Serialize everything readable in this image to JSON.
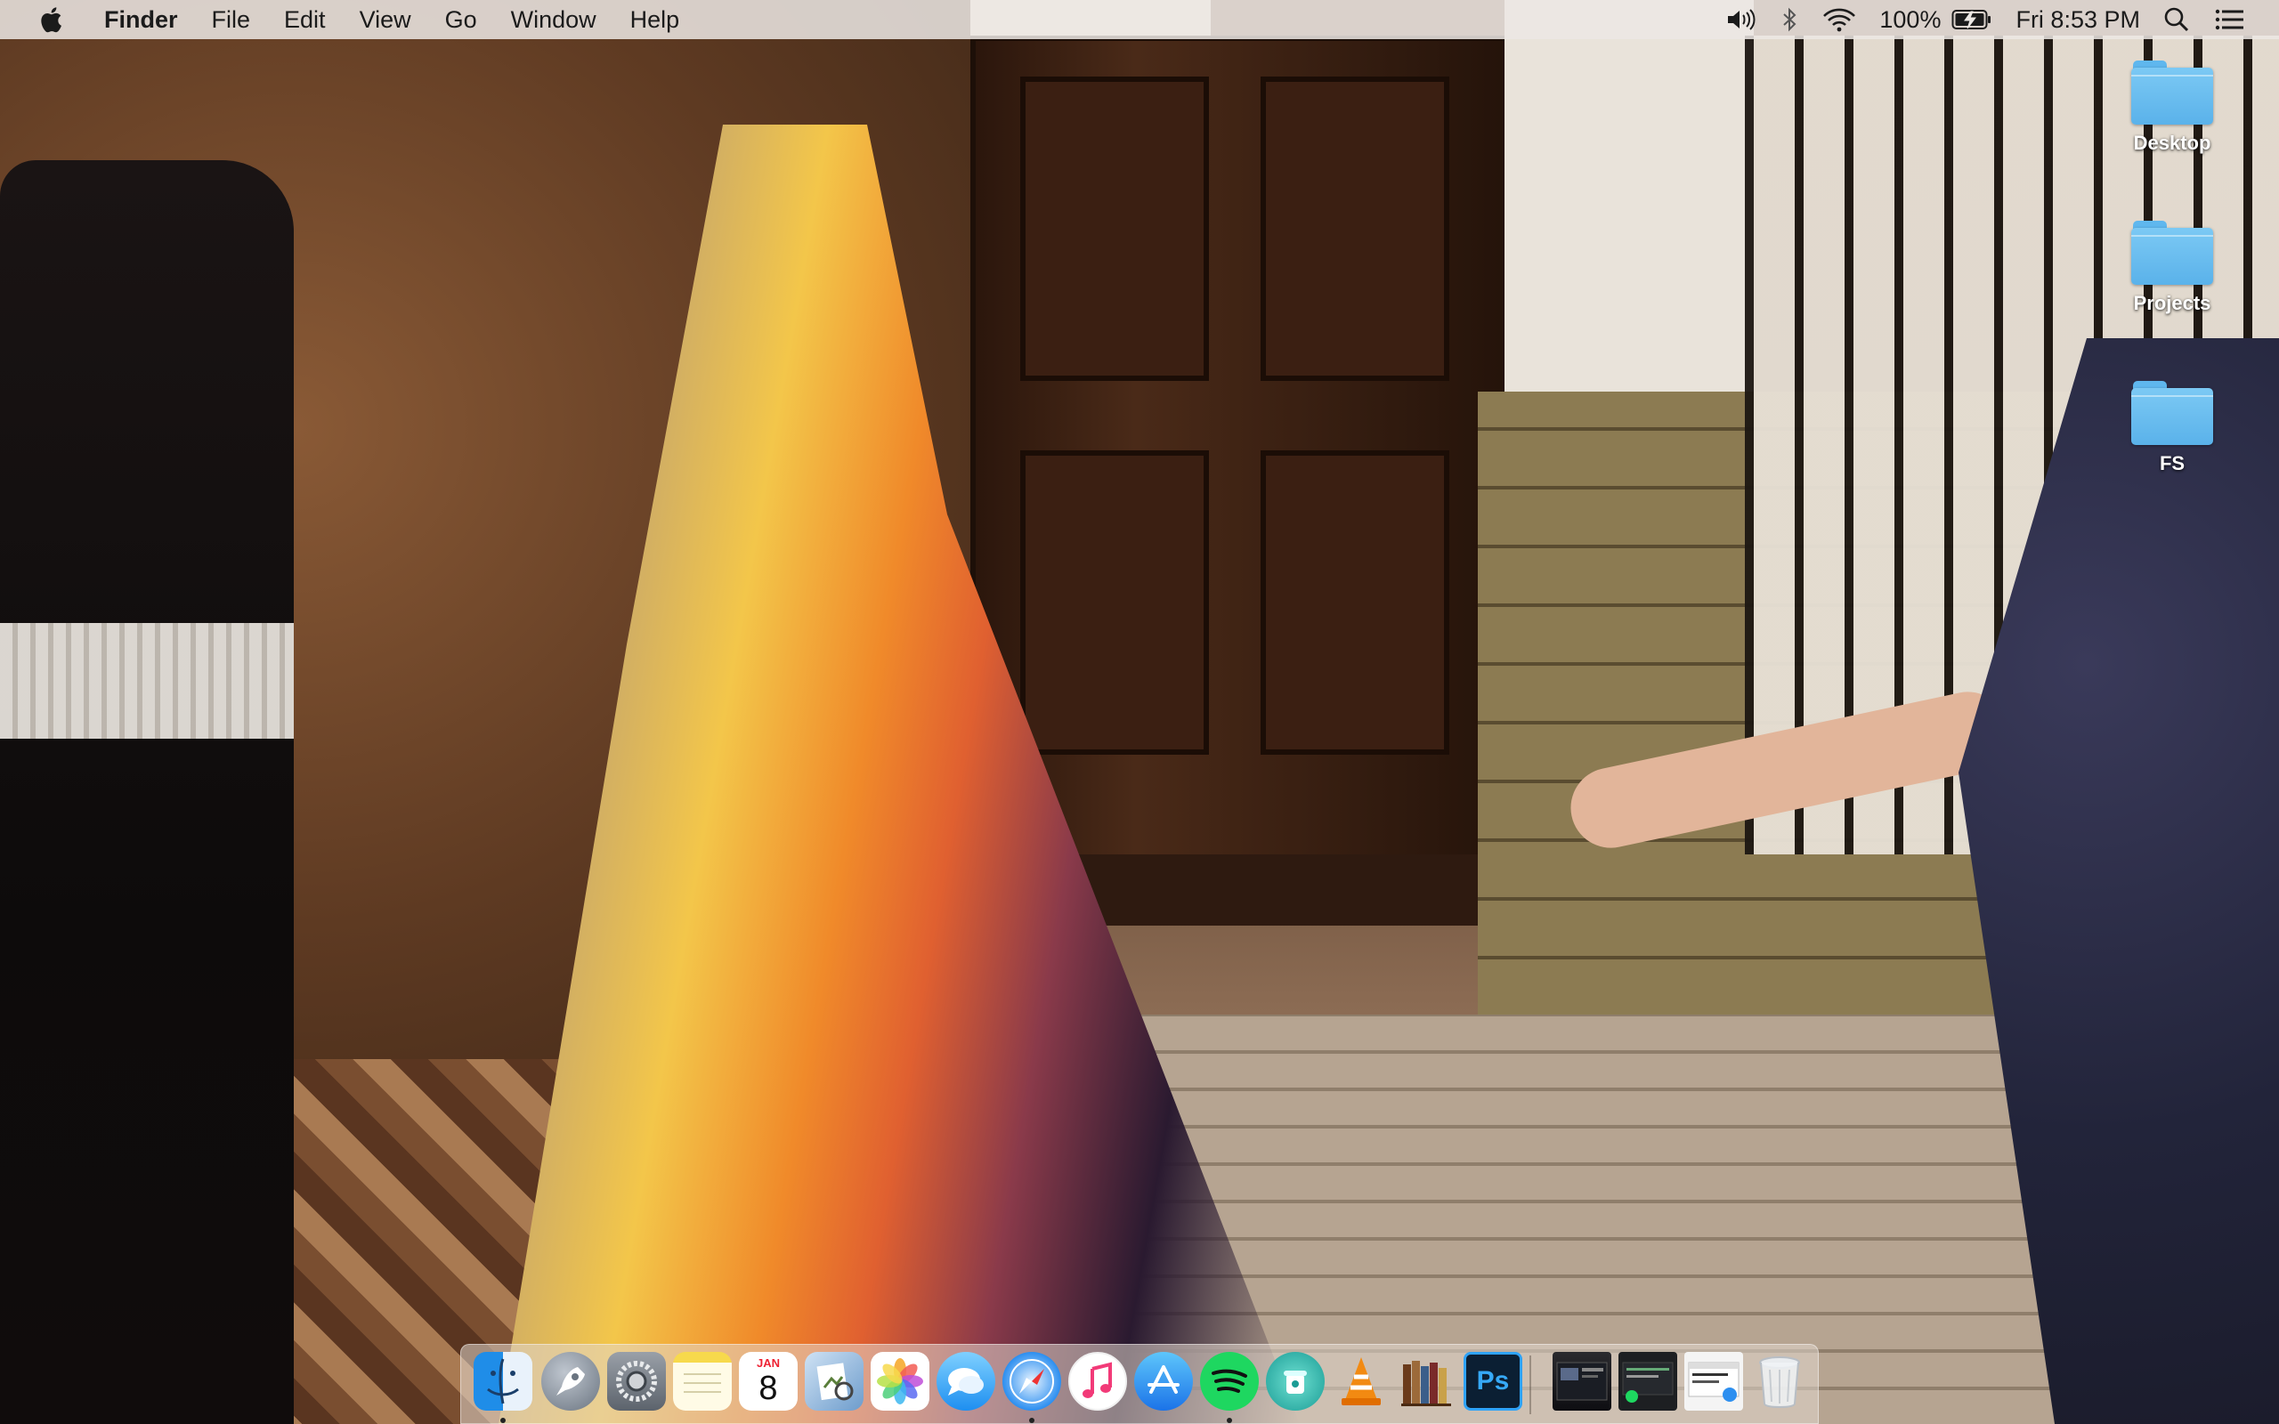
{
  "menubar": {
    "app_name": "Finder",
    "menus": [
      "File",
      "Edit",
      "View",
      "Go",
      "Window",
      "Help"
    ],
    "status": {
      "battery_percent": "100%",
      "datetime": "Fri 8:53 PM",
      "icons": [
        "volume-icon",
        "bluetooth-icon",
        "wifi-icon",
        "battery-charging-icon",
        "spotlight-search-icon",
        "notification-center-icon"
      ]
    }
  },
  "desktop": {
    "icons": [
      {
        "label": "Desktop",
        "icon": "folder-icon"
      },
      {
        "label": "Projects",
        "icon": "folder-icon"
      },
      {
        "label": "FS",
        "icon": "folder-icon"
      }
    ]
  },
  "dock": {
    "calendar": {
      "month": "JAN",
      "day": "8"
    },
    "photoshop_label": "Ps",
    "apps": [
      "Finder",
      "Launchpad",
      "System Preferences",
      "Notes",
      "Calendar",
      "Preview",
      "Photos",
      "Messages",
      "Safari",
      "iTunes",
      "App Store",
      "Spotify",
      "Cleaner",
      "VLC",
      "iBooks",
      "Photoshop"
    ],
    "running": [
      "Finder",
      "Safari",
      "Spotify"
    ],
    "recent": [
      "Window 1",
      "Window 2",
      "Window 3"
    ],
    "trash": "Trash"
  },
  "colors": {
    "folder_blue": "#6cc0f1",
    "menubar_bg": "#ece8e4"
  }
}
